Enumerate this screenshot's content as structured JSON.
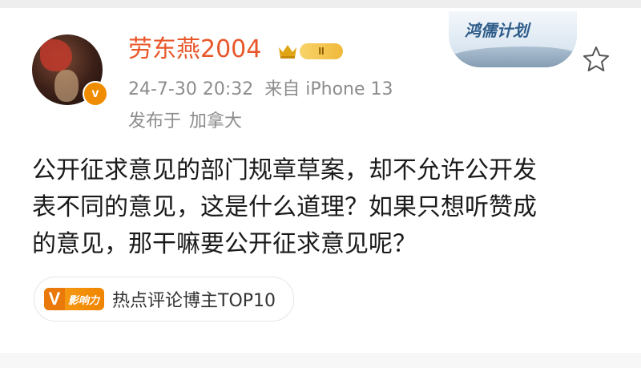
{
  "post": {
    "author": {
      "name": "劳东燕2004",
      "verified_badge": "v",
      "vip_level": "II"
    },
    "timestamp": "24-7-30 20:32",
    "source": "来自 iPhone 13",
    "location_prefix": "发布于",
    "location": "加拿大",
    "card_decoration_text": "鸿儒计划",
    "content_lines": [
      "公开征求意见的部门规章草案，却不允许公开发",
      "表不同的意见，这是什么道理？如果只想听赞成",
      "的意见，那干嘛要公开征求意见呢？"
    ],
    "tag": {
      "logo_letter": "V",
      "logo_text": "影响力",
      "label": "热点评论博主TOP10"
    }
  },
  "colors": {
    "username": "#e8572a",
    "meta": "#8c8c8c",
    "accent_orange": "#f08c00",
    "body_text": "#1a1a1a"
  },
  "icons": {
    "favorite": "star-outline-icon",
    "vip": "crown-icon"
  }
}
